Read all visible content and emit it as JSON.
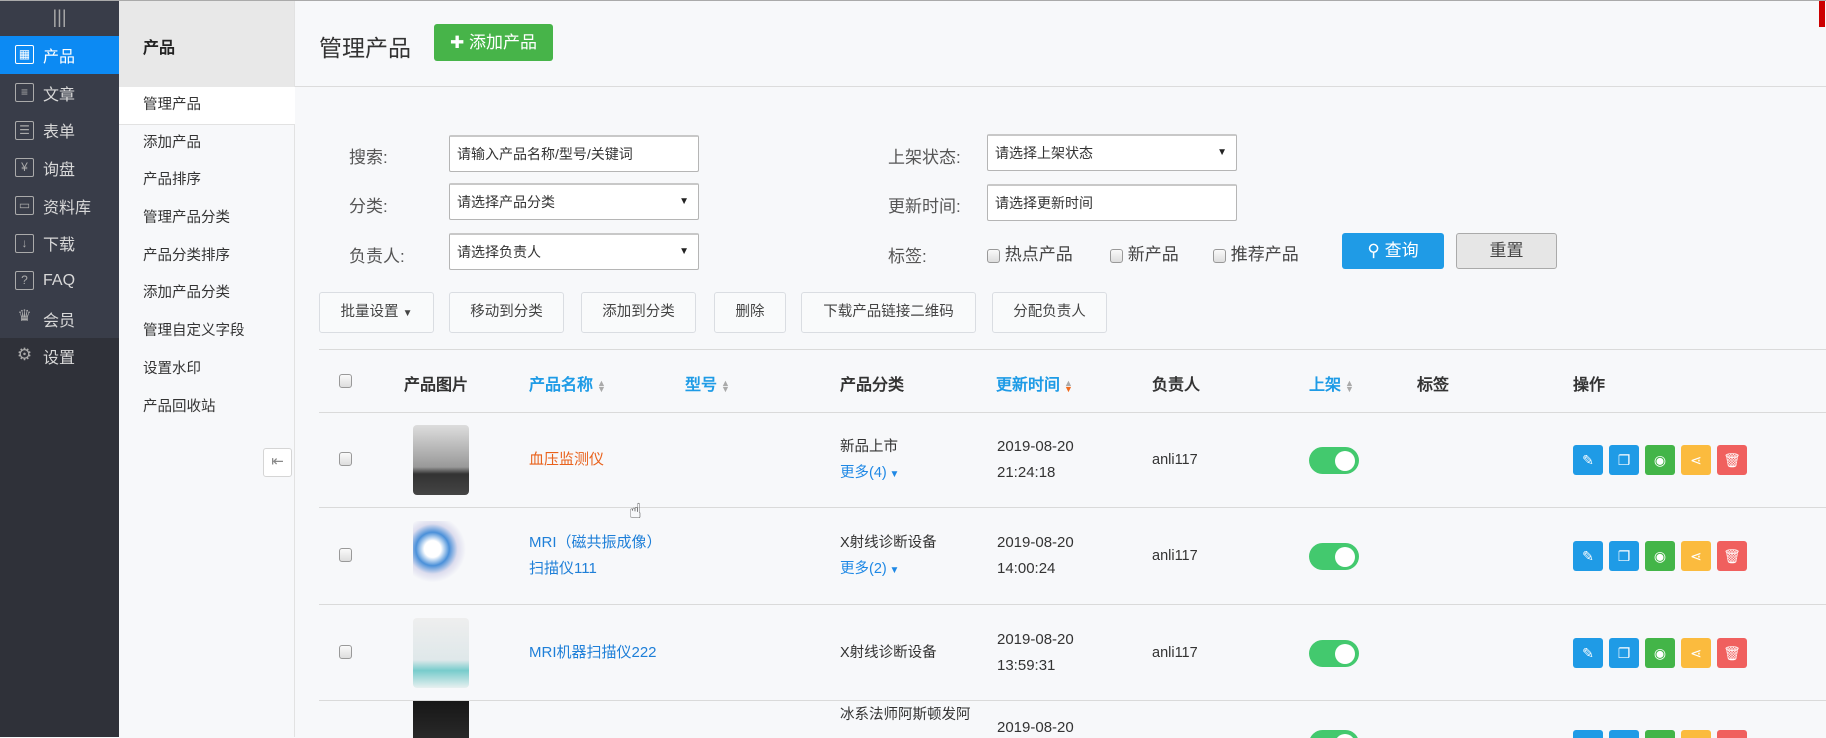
{
  "nav": {
    "menu_icon": "|||",
    "items": [
      {
        "label": "产品",
        "icon": "grid-icon"
      },
      {
        "label": "文章",
        "icon": "article-icon"
      },
      {
        "label": "表单",
        "icon": "form-icon"
      },
      {
        "label": "询盘",
        "icon": "inquiry-icon"
      },
      {
        "label": "资料库",
        "icon": "database-icon"
      },
      {
        "label": "下载",
        "icon": "download-icon"
      },
      {
        "label": "FAQ",
        "icon": "faq-icon"
      },
      {
        "label": "会员",
        "icon": "crown-icon"
      },
      {
        "label": "设置",
        "icon": "gear-icon"
      }
    ]
  },
  "subnav": {
    "title": "产品",
    "items": [
      "管理产品",
      "添加产品",
      "产品排序",
      "管理产品分类",
      "产品分类排序",
      "添加产品分类",
      "管理自定义字段",
      "设置水印",
      "产品回收站"
    ]
  },
  "header": {
    "title": "管理产品",
    "add_button": "添加产品"
  },
  "filters": {
    "search_label": "搜索:",
    "search_placeholder": "请输入产品名称/型号/关键词",
    "category_label": "分类:",
    "category_value": "请选择产品分类",
    "owner_label": "负责人:",
    "owner_value": "请选择负责人",
    "status_label": "上架状态:",
    "status_value": "请选择上架状态",
    "time_label": "更新时间:",
    "time_placeholder": "请选择更新时间",
    "tags_label": "标签:",
    "tags": [
      "热点产品",
      "新产品",
      "推荐产品"
    ],
    "query": "查询",
    "reset": "重置"
  },
  "actions": [
    "批量设置",
    "移动到分类",
    "添加到分类",
    "删除",
    "下载产品链接二维码",
    "分配负责人"
  ],
  "table": {
    "headers": {
      "image": "产品图片",
      "name": "产品名称",
      "model": "型号",
      "category": "产品分类",
      "updated": "更新时间",
      "owner": "负责人",
      "online": "上架",
      "tags": "标签",
      "ops": "操作"
    },
    "rows": [
      {
        "name1": "血压监测仪",
        "name2": "",
        "category": "新品上市",
        "more": "更多(4)",
        "date": "2019-08-20",
        "time": "21:24:18",
        "owner": "anli117",
        "online": true
      },
      {
        "name1": "MRI（磁共振成像）",
        "name2": "扫描仪111",
        "category": "X射线诊断设备",
        "more": "更多(2)",
        "date": "2019-08-20",
        "time": "14:00:24",
        "owner": "anli117",
        "online": true
      },
      {
        "name1": "MRI机器扫描仪222",
        "name2": "",
        "category": "X射线诊断设备",
        "more": "",
        "date": "2019-08-20",
        "time": "13:59:31",
        "owner": "anli117",
        "online": true
      },
      {
        "name1": "",
        "name2": "",
        "category": "冰系法师阿斯顿发阿",
        "more": "",
        "date": "2019-08-20",
        "time": "",
        "owner": "",
        "online": true
      }
    ]
  },
  "colors": {
    "primary": "#1f9be6",
    "green": "#47b449",
    "nav_active": "#0c8af3",
    "edit": "#1f9be6",
    "copy": "#1f9be6",
    "view": "#43b548",
    "share": "#fbbb3e",
    "delete": "#f0605e"
  }
}
